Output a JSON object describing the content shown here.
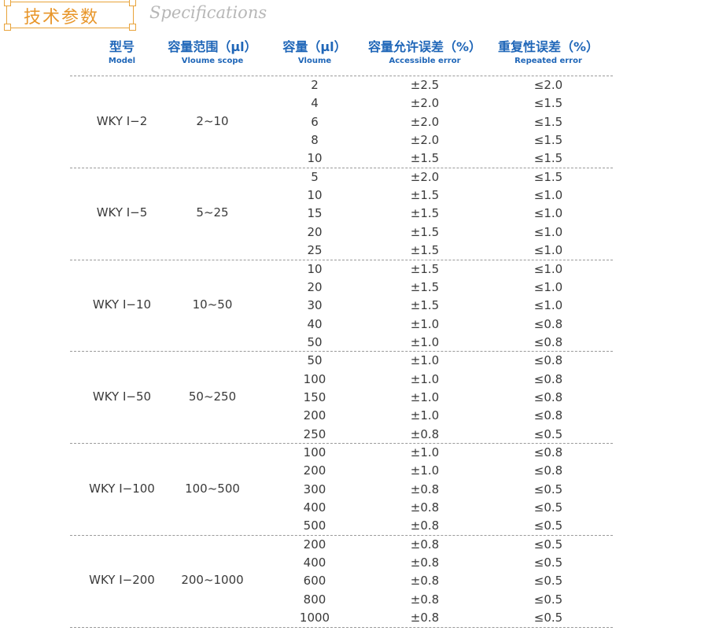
{
  "header": {
    "title_cn": "技术参数",
    "title_en": "Specifications"
  },
  "columns": [
    {
      "cn": "型号",
      "en": "Model"
    },
    {
      "cn": "容量范围（μl）",
      "en": "Vloume scope"
    },
    {
      "cn": "容量（μl）",
      "en": "Vloume"
    },
    {
      "cn": "容量允许误差（%）",
      "en": "Accessible error"
    },
    {
      "cn": "重复性误差（%）",
      "en": "Repeated error"
    }
  ],
  "groups": [
    {
      "model": "WKY I−2",
      "scope": "2~10",
      "rows": [
        {
          "volume": "2",
          "acc": "±2.5",
          "rep": "≤2.0"
        },
        {
          "volume": "4",
          "acc": "±2.0",
          "rep": "≤1.5"
        },
        {
          "volume": "6",
          "acc": "±2.0",
          "rep": "≤1.5"
        },
        {
          "volume": "8",
          "acc": "±2.0",
          "rep": "≤1.5"
        },
        {
          "volume": "10",
          "acc": "±1.5",
          "rep": "≤1.5"
        }
      ]
    },
    {
      "model": "WKY I−5",
      "scope": "5~25",
      "rows": [
        {
          "volume": "5",
          "acc": "±2.0",
          "rep": "≤1.5"
        },
        {
          "volume": "10",
          "acc": "±1.5",
          "rep": "≤1.0"
        },
        {
          "volume": "15",
          "acc": "±1.5",
          "rep": "≤1.0"
        },
        {
          "volume": "20",
          "acc": "±1.5",
          "rep": "≤1.0"
        },
        {
          "volume": "25",
          "acc": "±1.5",
          "rep": "≤1.0"
        }
      ]
    },
    {
      "model": "WKY I−10",
      "scope": "10~50",
      "rows": [
        {
          "volume": "10",
          "acc": "±1.5",
          "rep": "≤1.0"
        },
        {
          "volume": "20",
          "acc": "±1.5",
          "rep": "≤1.0"
        },
        {
          "volume": "30",
          "acc": "±1.5",
          "rep": "≤1.0"
        },
        {
          "volume": "40",
          "acc": "±1.0",
          "rep": "≤0.8"
        },
        {
          "volume": "50",
          "acc": "±1.0",
          "rep": "≤0.8"
        }
      ]
    },
    {
      "model": "WKY I−50",
      "scope": "50~250",
      "rows": [
        {
          "volume": "50",
          "acc": "±1.0",
          "rep": "≤0.8"
        },
        {
          "volume": "100",
          "acc": "±1.0",
          "rep": "≤0.8"
        },
        {
          "volume": "150",
          "acc": "±1.0",
          "rep": "≤0.8"
        },
        {
          "volume": "200",
          "acc": "±1.0",
          "rep": "≤0.8"
        },
        {
          "volume": "250",
          "acc": "±0.8",
          "rep": "≤0.5"
        }
      ]
    },
    {
      "model": "WKY I−100",
      "scope": "100~500",
      "rows": [
        {
          "volume": "100",
          "acc": "±1.0",
          "rep": "≤0.8"
        },
        {
          "volume": "200",
          "acc": "±1.0",
          "rep": "≤0.8"
        },
        {
          "volume": "300",
          "acc": "±0.8",
          "rep": "≤0.5"
        },
        {
          "volume": "400",
          "acc": "±0.8",
          "rep": "≤0.5"
        },
        {
          "volume": "500",
          "acc": "±0.8",
          "rep": "≤0.5"
        }
      ]
    },
    {
      "model": "WKY I−200",
      "scope": "200~1000",
      "rows": [
        {
          "volume": "200",
          "acc": "±0.8",
          "rep": "≤0.5"
        },
        {
          "volume": "400",
          "acc": "±0.8",
          "rep": "≤0.5"
        },
        {
          "volume": "600",
          "acc": "±0.8",
          "rep": "≤0.5"
        },
        {
          "volume": "800",
          "acc": "±0.8",
          "rep": "≤0.5"
        },
        {
          "volume": "1000",
          "acc": "±0.8",
          "rep": "≤0.5"
        }
      ]
    }
  ],
  "colors": {
    "accent": "#e8962a",
    "header_blue": "#1f66b8",
    "text": "#3a3a3a"
  }
}
